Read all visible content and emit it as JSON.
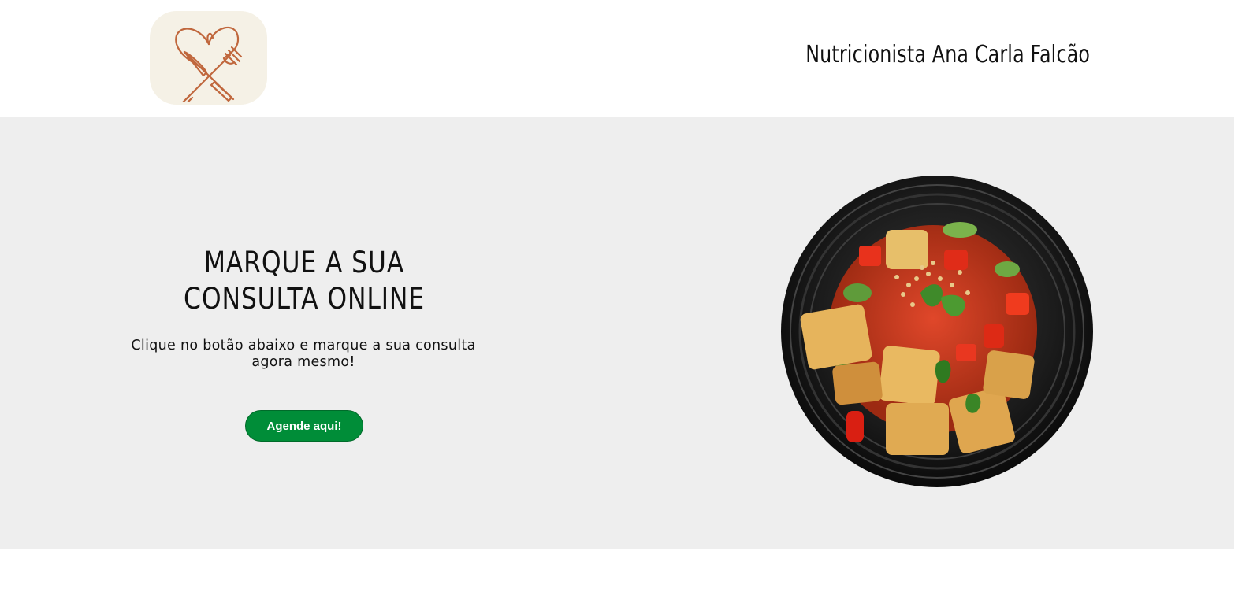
{
  "header": {
    "logo_icon": "heart-fork-knife-icon",
    "logo_color": "#c0673d",
    "title": "Nutricionista Ana Carla Falcão"
  },
  "hero": {
    "title_line1": "Marque a sua",
    "title_line2": "consulta online",
    "text": "Clique no botão abaixo e marque a sua consulta agora mesmo!",
    "cta_label": "Agende aqui!",
    "cta_color": "#008d38",
    "image_icon": "food-bowl-image"
  }
}
